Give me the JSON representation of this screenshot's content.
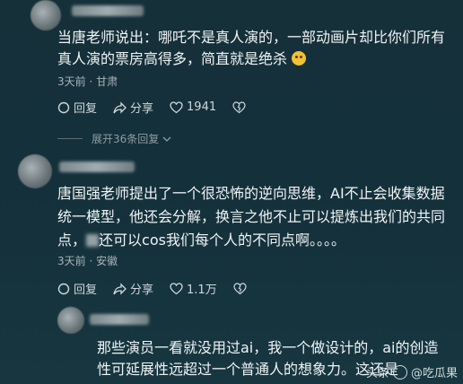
{
  "comments": [
    {
      "text_lines": [
        "当唐老师说出：哪吒不是真人演的，一部动画片却比你们所有",
        "真人演的票房高得多，简直就是绝杀"
      ],
      "meta": "3天前 · 甘肃",
      "reply_label": "回复",
      "share_label": "分享",
      "likes": "1941",
      "collapse_label": "展开36条回复"
    },
    {
      "text_lines": [
        "唐国强老师提出了一个很恐怖的逆向思维，AI不止会收集数据",
        "统一模型，他还会分解，换言之他不止可以提炼出我们的共同",
        "点，",
        "还可以cos我们每个人的不同点啊。。。。"
      ],
      "meta": "3天前 · 安徽",
      "reply_label": "回复",
      "share_label": "分享",
      "likes": "1.1万"
    },
    {
      "text_lines": [
        "那些演员一看就没用过ai，我一个做设计的，ai的创造",
        "性可延展性远超过一个普通人的想象力。这还是"
      ]
    }
  ],
  "watermark": {
    "prefix": "头条",
    "account": "@吃瓜果"
  }
}
